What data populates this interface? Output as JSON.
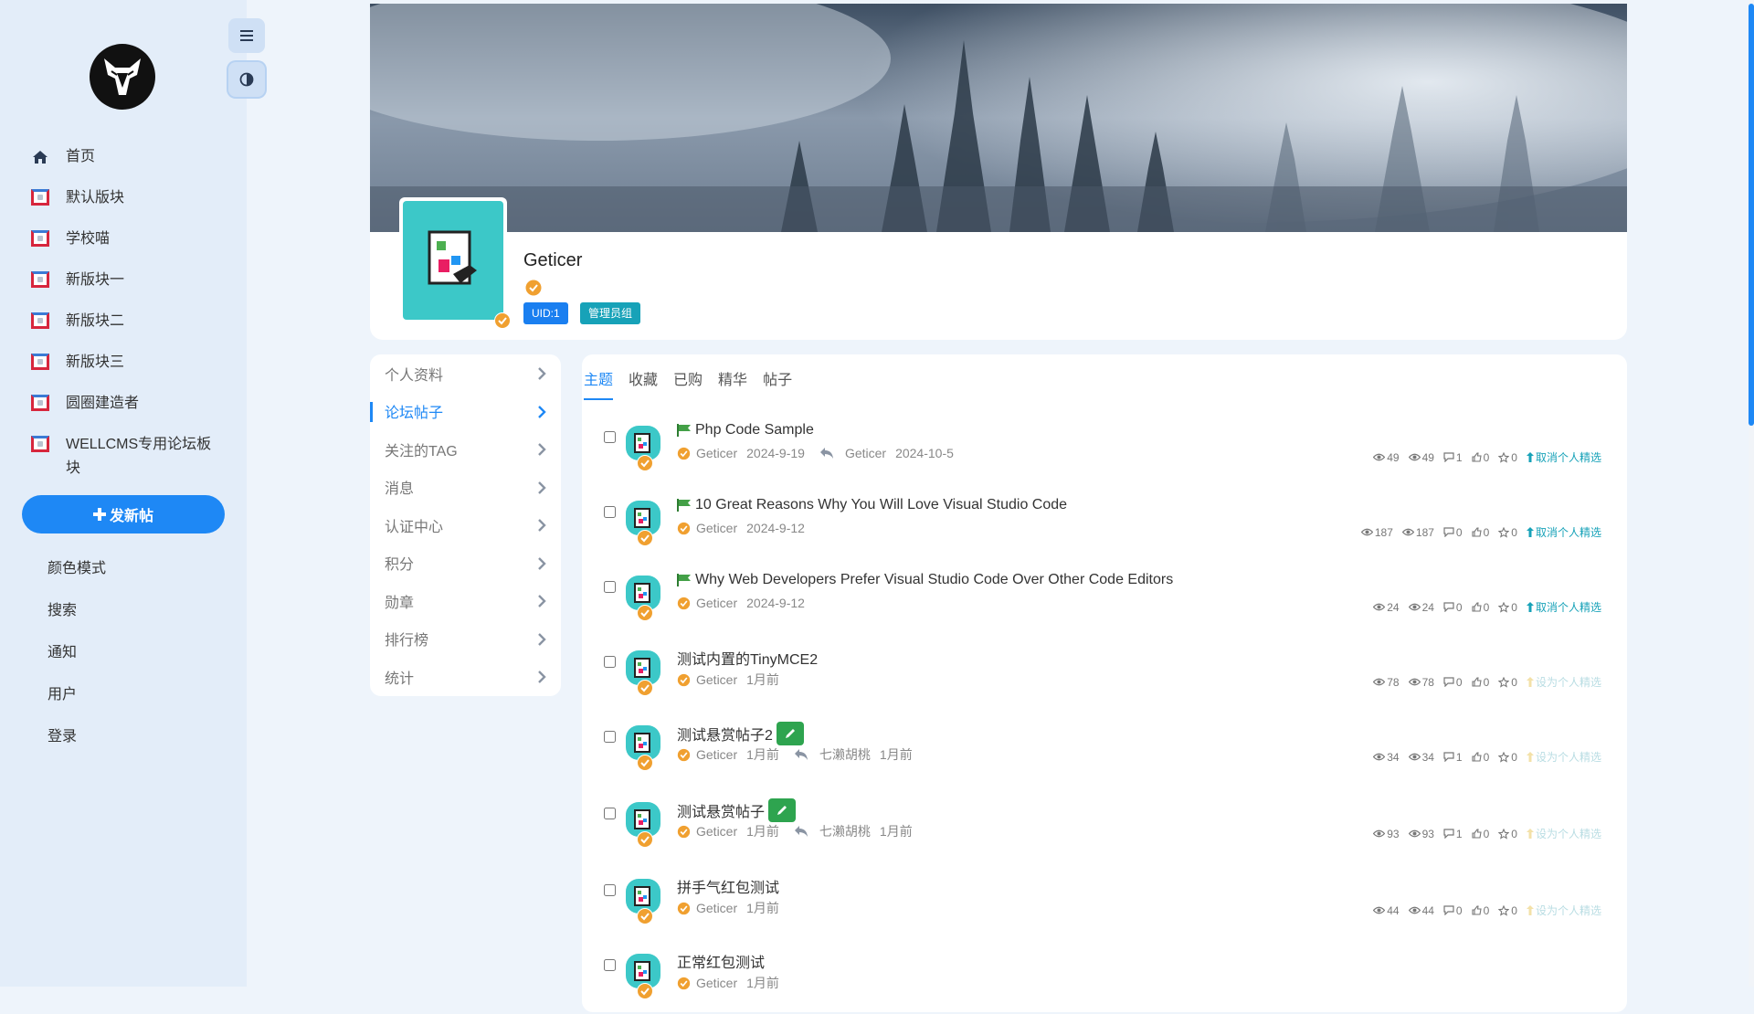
{
  "sidebar": {
    "home": "首页",
    "forums": [
      "默认版块",
      "学校喵",
      "新版块一",
      "新版块二",
      "新版块三",
      "圆圈建造者",
      "WELLCMS专用论坛板块"
    ],
    "post_button": "发新帖",
    "sub_nav": [
      "颜色模式",
      "搜索",
      "通知",
      "用户",
      "登录"
    ]
  },
  "profile": {
    "username": "Geticer",
    "uid_tag": "UID:1",
    "group_tag": "管理员组"
  },
  "menu": {
    "items": [
      "个人资料",
      "论坛帖子",
      "关注的TAG",
      "消息",
      "认证中心",
      "积分",
      "勋章",
      "排行榜",
      "统计"
    ],
    "active_index": 1
  },
  "tabs": {
    "items": [
      "主题",
      "收藏",
      "已购",
      "精华",
      "帖子"
    ],
    "active_index": 0
  },
  "threads": [
    {
      "title": "Php Code Sample",
      "flag": true,
      "reward": false,
      "author": "Geticer",
      "date": "2024-9-19",
      "reply_user": "Geticer",
      "reply_date": "2024-10-5",
      "views": "49",
      "views2": "49",
      "comments": "1",
      "likes": "0",
      "favs": "0",
      "pick": "取消个人精选",
      "pick_on": true
    },
    {
      "title": "10 Great Reasons Why You Will Love Visual Studio Code",
      "flag": true,
      "reward": false,
      "author": "Geticer",
      "date": "2024-9-12",
      "reply_user": "",
      "reply_date": "",
      "views": "187",
      "views2": "187",
      "comments": "0",
      "likes": "0",
      "favs": "0",
      "pick": "取消个人精选",
      "pick_on": true
    },
    {
      "title": "Why Web Developers Prefer Visual Studio Code Over Other Code Editors",
      "flag": true,
      "reward": false,
      "author": "Geticer",
      "date": "2024-9-12",
      "reply_user": "",
      "reply_date": "",
      "views": "24",
      "views2": "24",
      "comments": "0",
      "likes": "0",
      "favs": "0",
      "pick": "取消个人精选",
      "pick_on": true
    },
    {
      "title": "测试内置的TinyMCE2",
      "flag": false,
      "reward": false,
      "author": "Geticer",
      "date": "1月前",
      "reply_user": "",
      "reply_date": "",
      "views": "78",
      "views2": "78",
      "comments": "0",
      "likes": "0",
      "favs": "0",
      "pick": "设为个人精选",
      "pick_on": false
    },
    {
      "title": "测试悬赏帖子2",
      "flag": false,
      "reward": true,
      "author": "Geticer",
      "date": "1月前",
      "reply_user": "七濑胡桃",
      "reply_date": "1月前",
      "views": "34",
      "views2": "34",
      "comments": "1",
      "likes": "0",
      "favs": "0",
      "pick": "设为个人精选",
      "pick_on": false
    },
    {
      "title": "测试悬赏帖子",
      "flag": false,
      "reward": true,
      "author": "Geticer",
      "date": "1月前",
      "reply_user": "七濑胡桃",
      "reply_date": "1月前",
      "views": "93",
      "views2": "93",
      "comments": "1",
      "likes": "0",
      "favs": "0",
      "pick": "设为个人精选",
      "pick_on": false
    },
    {
      "title": "拼手气红包测试",
      "flag": false,
      "reward": false,
      "author": "Geticer",
      "date": "1月前",
      "reply_user": "",
      "reply_date": "",
      "views": "44",
      "views2": "44",
      "comments": "0",
      "likes": "0",
      "favs": "0",
      "pick": "设为个人精选",
      "pick_on": false
    },
    {
      "title": "正常红包测试",
      "flag": false,
      "reward": false,
      "author": "Geticer",
      "date": "1月前",
      "reply_user": "",
      "reply_date": "",
      "views": "",
      "views2": "",
      "comments": "",
      "likes": "",
      "favs": "",
      "pick": "",
      "pick_on": false
    }
  ],
  "colors": {
    "accent": "#1e88f5",
    "teal": "#17a2b8",
    "avatar": "#3cc8c8",
    "verify": "#f0a030"
  }
}
